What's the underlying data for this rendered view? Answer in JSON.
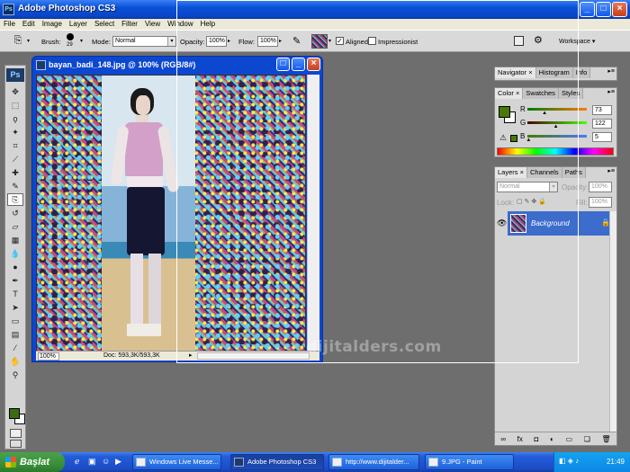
{
  "window": {
    "title": "Adobe Photoshop CS3",
    "app_icon": "Ps",
    "minimize": "_",
    "maximize": "□",
    "close": "×"
  },
  "menu": [
    "File",
    "Edit",
    "Image",
    "Layer",
    "Select",
    "Filter",
    "View",
    "Window",
    "Help"
  ],
  "options": {
    "brush_label": "Brush:",
    "brush_size": "29",
    "mode_label": "Mode:",
    "mode_value": "Normal",
    "opacity_label": "Opacity:",
    "opacity_value": "100%",
    "flow_label": "Flow:",
    "flow_value": "100%",
    "aligned_label": "Aligned",
    "aligned_checked": "✓",
    "impressionist_label": "Impressionist",
    "workspace_label": "Workspace ▾"
  },
  "toolbox": {
    "logo": "Ps",
    "tools": [
      "move-tool",
      "marquee-tool",
      "lasso-tool",
      "magic-wand-tool",
      "crop-tool",
      "slice-tool",
      "healing-brush-tool",
      "brush-tool",
      "clone-stamp-tool",
      "history-brush-tool",
      "eraser-tool",
      "gradient-tool",
      "blur-tool",
      "dodge-tool",
      "pen-tool",
      "type-tool",
      "path-selection-tool",
      "shape-tool",
      "notes-tool",
      "eyedropper-tool",
      "hand-tool",
      "zoom-tool"
    ],
    "foreground_color": "#3b6b12",
    "background_color": "#ffffff"
  },
  "document": {
    "title": "bayan_badi_148.jpg @ 100% (RGB/8#)",
    "zoom": "100%",
    "doc_info": "Doc: 593,3K/593,3K"
  },
  "watermark": "dijitalders.com",
  "navigator_panel": {
    "tabs": [
      "Navigator",
      "Histogram",
      "Info"
    ]
  },
  "color_panel": {
    "tabs": [
      "Color",
      "Swatches",
      "Styles"
    ],
    "channels": [
      {
        "label": "R",
        "value": "73",
        "fraction": 0.29
      },
      {
        "label": "G",
        "value": "122",
        "fraction": 0.48
      },
      {
        "label": "B",
        "value": "5",
        "fraction": 0.02
      }
    ],
    "swatch_color": "#497a05"
  },
  "layers_panel": {
    "tabs": [
      "Layers",
      "Channels",
      "Paths"
    ],
    "blend_mode": "Normal",
    "opacity_label": "Opacity:",
    "opacity_value": "100%",
    "lock_label": "Lock:",
    "fill_label": "Fill:",
    "fill_value": "100%",
    "layer_name": "Background"
  },
  "taskbar": {
    "start_label": "Başlat",
    "tasks": [
      {
        "label": "Windows Live Messe...",
        "active": false
      },
      {
        "label": "Adobe Photoshop CS3",
        "active": true
      },
      {
        "label": "http://www.dijitalder...",
        "active": false
      },
      {
        "label": "9.JPG - Paint",
        "active": false
      }
    ],
    "clock": "21:49"
  }
}
